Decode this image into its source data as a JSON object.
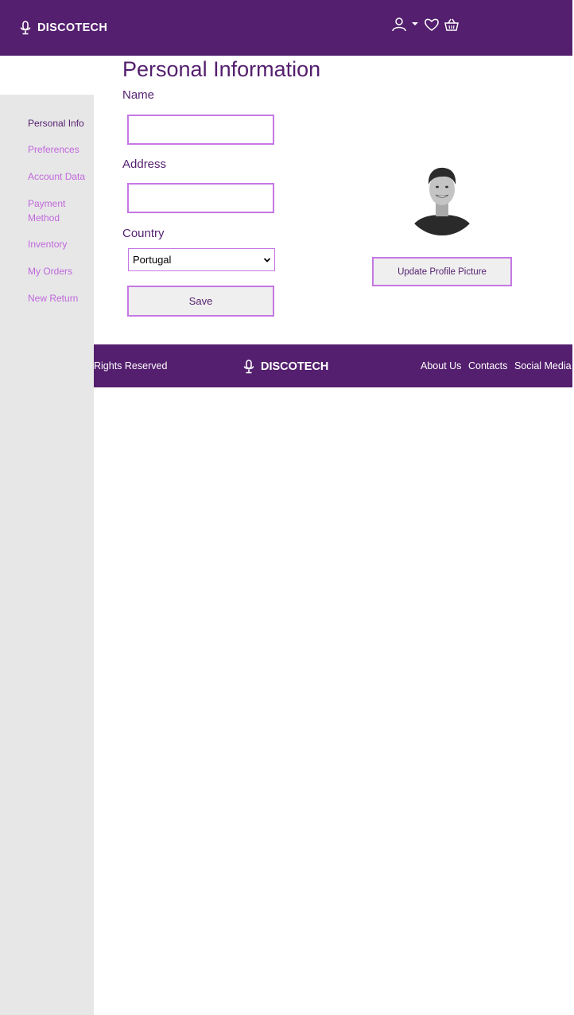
{
  "header": {
    "brand": "DISCOTECH",
    "icons": [
      "microphone-icon",
      "user-icon",
      "caret-down-icon",
      "heart-icon",
      "basket-icon"
    ]
  },
  "sidebar": {
    "items": [
      {
        "label": "Personal Info",
        "active": true
      },
      {
        "label": "Preferences",
        "active": false
      },
      {
        "label": "Account Data",
        "active": false
      },
      {
        "label": "Payment Method",
        "active": false
      },
      {
        "label": "Inventory",
        "active": false
      },
      {
        "label": "My Orders",
        "active": false
      },
      {
        "label": "New Return",
        "active": false
      }
    ]
  },
  "main": {
    "title": "Personal Information",
    "name_label": "Name",
    "name_value": "",
    "address_label": "Address",
    "address_value": "",
    "country_label": "Country",
    "country_selected": "Portugal",
    "save_label": "Save",
    "update_picture_label": "Update Profile Picture"
  },
  "footer": {
    "copyright_visible": "Rights Reserved",
    "brand": "DISCOTECH",
    "links": [
      "About Us",
      "Contacts",
      "Social Media"
    ]
  },
  "colors": {
    "primary": "#541f6e",
    "accent": "#c577e4",
    "sidebar_bg": "#e7e7e7",
    "button_bg": "#efefef"
  }
}
